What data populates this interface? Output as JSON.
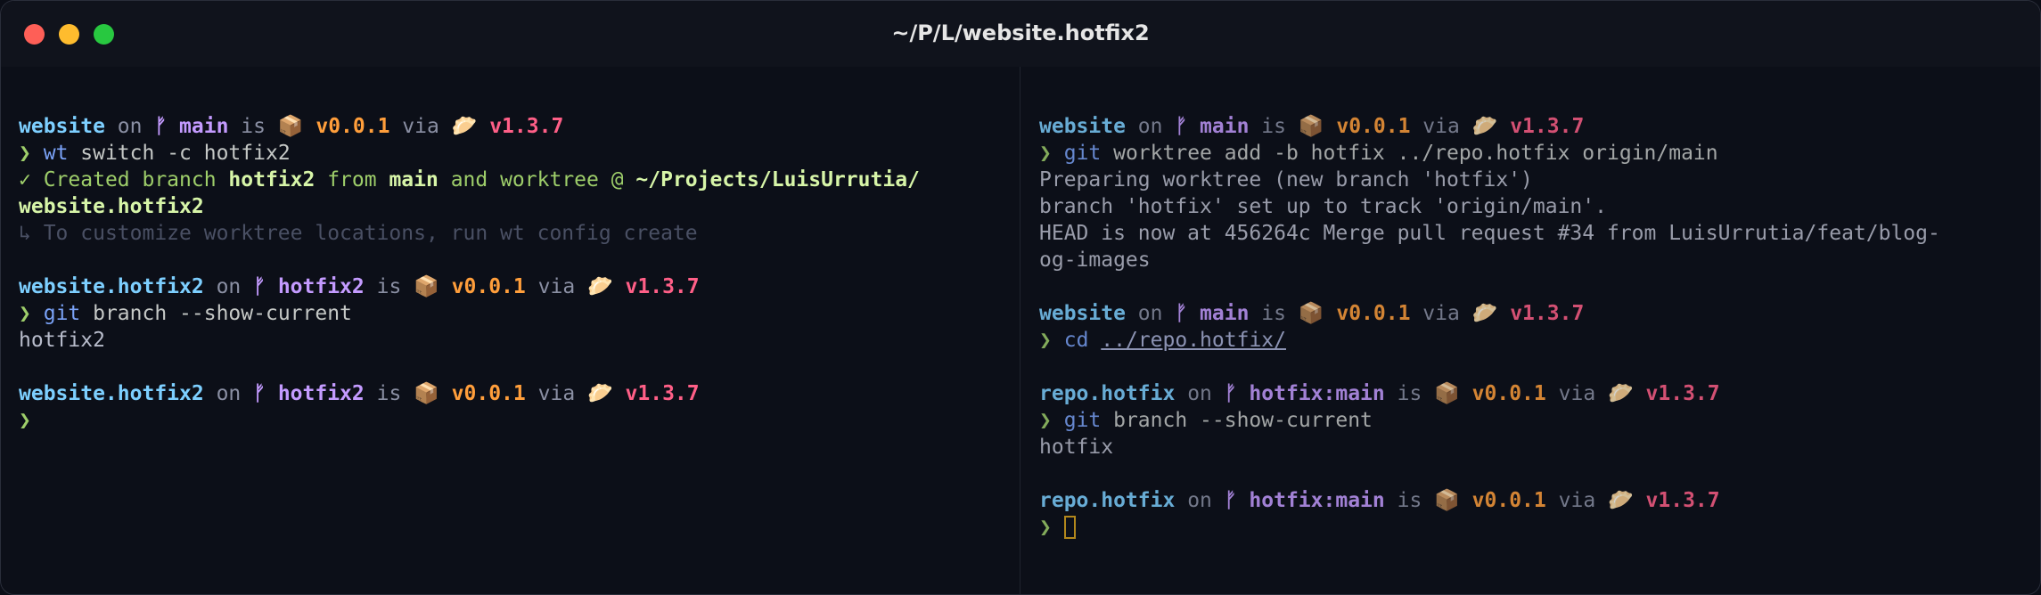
{
  "window": {
    "title": "~/P/L/website.hotfix2",
    "controls": [
      "close",
      "minimize",
      "zoom"
    ]
  },
  "icons": {
    "branch": "git-branch-icon",
    "package": "package-icon",
    "runtime": "bun-icon"
  },
  "colors": {
    "directory": "#7dcfff",
    "branch": "#c49bff",
    "package_version": "#ff9e3b",
    "runtime_version": "#ff5f87",
    "prompt": "#9ece6a"
  },
  "glyphs": {
    "prompt": "❯",
    "branch": "ᚠ",
    "package": "📦",
    "runtime": "🥟",
    "check": "✓",
    "arrow": "↳"
  },
  "words": {
    "on": "on",
    "is": "is",
    "via": "via"
  },
  "left": {
    "p1": {
      "dir": "website",
      "branch": "main",
      "pkg": "v0.0.1",
      "runtime": "v1.3.7"
    },
    "c1": {
      "name": "wt",
      "args": " switch -c hotfix2"
    },
    "created": {
      "t1": " Created branch ",
      "b1": "hotfix2",
      "t2": " from ",
      "b2": "main",
      "t3": " and worktree @ ",
      "path1": "~/Projects/LuisUrrutia/",
      "path2": "website.hotfix2"
    },
    "hint": " To customize worktree locations, run wt config create",
    "p2": {
      "dir": "website.hotfix2",
      "branch": "hotfix2",
      "pkg": "v0.0.1",
      "runtime": "v1.3.7"
    },
    "c2": {
      "name": "git",
      "args": " branch --show-current"
    },
    "o2": "hotfix2",
    "p3": {
      "dir": "website.hotfix2",
      "branch": "hotfix2",
      "pkg": "v0.0.1",
      "runtime": "v1.3.7"
    }
  },
  "right": {
    "p1": {
      "dir": "website",
      "branch": "main",
      "pkg": "v0.0.1",
      "runtime": "v1.3.7"
    },
    "c1": {
      "name": "git",
      "args": " worktree add -b hotfix ../repo.hotfix origin/main"
    },
    "o1": [
      "Preparing worktree (new branch 'hotfix')",
      "branch 'hotfix' set up to track 'origin/main'.",
      "HEAD is now at 456264c Merge pull request #34 from LuisUrrutia/feat/blog-",
      "og-images"
    ],
    "p2": {
      "dir": "website",
      "branch": "main",
      "pkg": "v0.0.1",
      "runtime": "v1.3.7"
    },
    "c2": {
      "name": "cd",
      "args": "../repo.hotfix/"
    },
    "p3": {
      "dir": "repo.hotfix",
      "branch": "hotfix:main",
      "pkg": "v0.0.1",
      "runtime": "v1.3.7"
    },
    "c3": {
      "name": "git",
      "args": " branch --show-current"
    },
    "o3": "hotfix",
    "p4": {
      "dir": "repo.hotfix",
      "branch": "hotfix:main",
      "pkg": "v0.0.1",
      "runtime": "v1.3.7"
    }
  }
}
